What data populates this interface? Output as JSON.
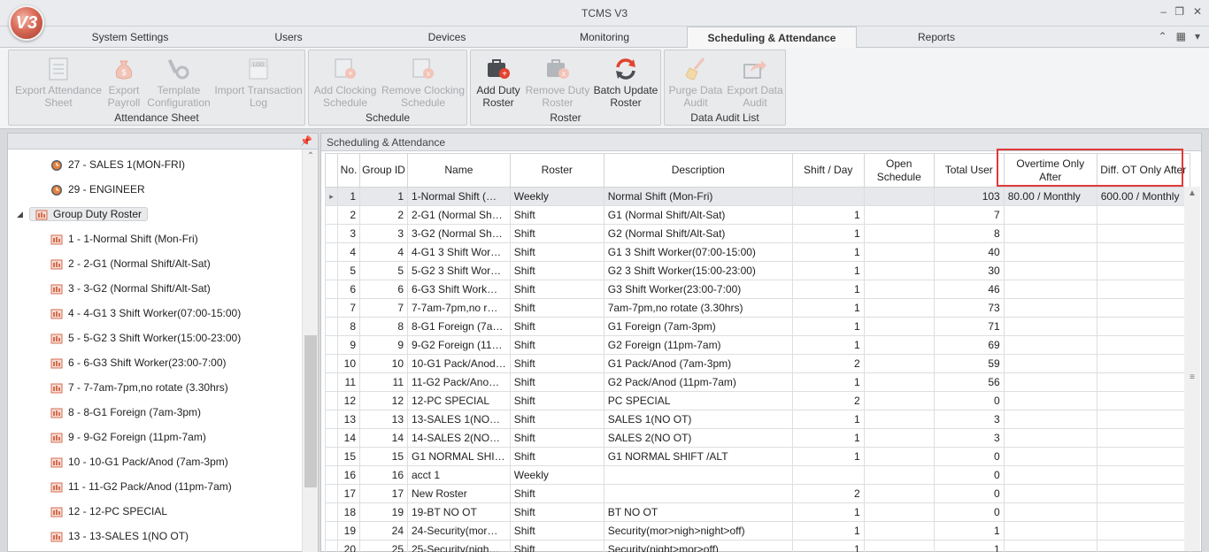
{
  "window": {
    "title": "TCMS V3",
    "logo_text": "V3"
  },
  "tabs": [
    {
      "label": "System Settings"
    },
    {
      "label": "Users"
    },
    {
      "label": "Devices"
    },
    {
      "label": "Monitoring"
    },
    {
      "label": "Scheduling & Attendance",
      "active": true
    },
    {
      "label": "Reports"
    }
  ],
  "ribbon": {
    "groups": [
      {
        "name": "Attendance Sheet",
        "buttons": [
          {
            "label1": "Export Attendance",
            "label2": "Sheet",
            "icon": "sheet-icon",
            "enabled": false
          },
          {
            "label1": "Export",
            "label2": "Payroll",
            "icon": "money-bag-icon",
            "enabled": false
          },
          {
            "label1": "Template",
            "label2": "Configuration",
            "icon": "tools-icon",
            "enabled": false
          },
          {
            "label1": "Import Transaction",
            "label2": "Log",
            "icon": "log-icon",
            "enabled": false
          }
        ]
      },
      {
        "name": "Schedule",
        "buttons": [
          {
            "label1": "Add Clocking",
            "label2": "Schedule",
            "icon": "add-schedule-icon",
            "enabled": false
          },
          {
            "label1": "Remove Clocking",
            "label2": "Schedule",
            "icon": "remove-schedule-icon",
            "enabled": false
          }
        ]
      },
      {
        "name": "Roster",
        "buttons": [
          {
            "label1": "Add Duty",
            "label2": "Roster",
            "icon": "add-roster-icon",
            "enabled": true
          },
          {
            "label1": "Remove Duty",
            "label2": "Roster",
            "icon": "remove-roster-icon",
            "enabled": false
          },
          {
            "label1": "Batch Update",
            "label2": "Roster",
            "icon": "refresh-icon",
            "enabled": true
          }
        ]
      },
      {
        "name": "Data Audit List",
        "buttons": [
          {
            "label1": "Purge Data",
            "label2": "Audit",
            "icon": "broom-icon",
            "enabled": false
          },
          {
            "label1": "Export Data",
            "label2": "Audit",
            "icon": "export-icon",
            "enabled": false
          }
        ]
      }
    ]
  },
  "tree": {
    "items": [
      {
        "label": "27 - SALES 1(MON-FRI)",
        "level": 2,
        "icon": "clock-icon"
      },
      {
        "label": "29 - ENGINEER",
        "level": 2,
        "icon": "clock-icon"
      },
      {
        "label": "Group Duty Roster",
        "level": 1,
        "icon": "roster-icon",
        "expanded": true
      },
      {
        "label": "1 - 1-Normal Shift (Mon-Fri)",
        "level": 2,
        "icon": "roster-icon"
      },
      {
        "label": "2 - 2-G1 (Normal Shift/Alt-Sat)",
        "level": 2,
        "icon": "roster-icon"
      },
      {
        "label": "3 - 3-G2 (Normal Shift/Alt-Sat)",
        "level": 2,
        "icon": "roster-icon"
      },
      {
        "label": "4 - 4-G1 3 Shift Worker(07:00-15:00)",
        "level": 2,
        "icon": "roster-icon"
      },
      {
        "label": "5 - 5-G2 3 Shift Worker(15:00-23:00)",
        "level": 2,
        "icon": "roster-icon"
      },
      {
        "label": "6 - 6-G3 Shift Worker(23:00-7:00)",
        "level": 2,
        "icon": "roster-icon"
      },
      {
        "label": "7 - 7-7am-7pm,no rotate (3.30hrs)",
        "level": 2,
        "icon": "roster-icon"
      },
      {
        "label": "8 - 8-G1 Foreign (7am-3pm)",
        "level": 2,
        "icon": "roster-icon"
      },
      {
        "label": "9 - 9-G2 Foreign (11pm-7am)",
        "level": 2,
        "icon": "roster-icon"
      },
      {
        "label": "10 - 10-G1 Pack/Anod (7am-3pm)",
        "level": 2,
        "icon": "roster-icon"
      },
      {
        "label": "11 - 11-G2 Pack/Anod (11pm-7am)",
        "level": 2,
        "icon": "roster-icon"
      },
      {
        "label": "12 - 12-PC SPECIAL",
        "level": 2,
        "icon": "roster-icon"
      },
      {
        "label": "13 - 13-SALES 1(NO OT)",
        "level": 2,
        "icon": "roster-icon"
      }
    ]
  },
  "main": {
    "panel_title": "Scheduling & Attendance",
    "columns": [
      "No.",
      "Group ID",
      "Name",
      "Roster",
      "Description",
      "Shift / Day",
      "Open Schedule",
      "Total User",
      "Overtime Only After",
      "Diff. OT Only After"
    ],
    "rows": [
      [
        "1",
        "1",
        "1-Normal Shift (…",
        "Weekly",
        "Normal Shift (Mon-Fri)",
        "",
        "",
        "103",
        "80.00 / Monthly",
        "600.00 / Monthly"
      ],
      [
        "2",
        "2",
        "2-G1 (Normal Sh…",
        "Shift",
        "G1 (Normal Shift/Alt-Sat)",
        "1",
        "",
        "7",
        "",
        ""
      ],
      [
        "3",
        "3",
        "3-G2 (Normal Sh…",
        "Shift",
        "G2 (Normal Shift/Alt-Sat)",
        "1",
        "",
        "8",
        "",
        ""
      ],
      [
        "4",
        "4",
        "4-G1 3 Shift Wor…",
        "Shift",
        "G1 3 Shift Worker(07:00-15:00)",
        "1",
        "",
        "40",
        "",
        ""
      ],
      [
        "5",
        "5",
        "5-G2 3 Shift Wor…",
        "Shift",
        "G2 3 Shift Worker(15:00-23:00)",
        "1",
        "",
        "30",
        "",
        ""
      ],
      [
        "6",
        "6",
        "6-G3 Shift Work…",
        "Shift",
        "G3 Shift Worker(23:00-7:00)",
        "1",
        "",
        "46",
        "",
        ""
      ],
      [
        "7",
        "7",
        "7-7am-7pm,no r…",
        "Shift",
        "7am-7pm,no rotate (3.30hrs)",
        "1",
        "",
        "73",
        "",
        ""
      ],
      [
        "8",
        "8",
        "8-G1 Foreign (7a…",
        "Shift",
        "G1 Foreign (7am-3pm)",
        "1",
        "",
        "71",
        "",
        ""
      ],
      [
        "9",
        "9",
        "9-G2 Foreign (11…",
        "Shift",
        "G2 Foreign (11pm-7am)",
        "1",
        "",
        "69",
        "",
        ""
      ],
      [
        "10",
        "10",
        "10-G1 Pack/Anod…",
        "Shift",
        "G1 Pack/Anod (7am-3pm)",
        "2",
        "",
        "59",
        "",
        ""
      ],
      [
        "11",
        "11",
        "11-G2 Pack/Ano…",
        "Shift",
        "G2 Pack/Anod (11pm-7am)",
        "1",
        "",
        "56",
        "",
        ""
      ],
      [
        "12",
        "12",
        "12-PC SPECIAL",
        "Shift",
        "PC SPECIAL",
        "2",
        "",
        "0",
        "",
        ""
      ],
      [
        "13",
        "13",
        "13-SALES 1(NO…",
        "Shift",
        "SALES 1(NO OT)",
        "1",
        "",
        "3",
        "",
        ""
      ],
      [
        "14",
        "14",
        "14-SALES 2(NO…",
        "Shift",
        "SALES 2(NO OT)",
        "1",
        "",
        "3",
        "",
        ""
      ],
      [
        "15",
        "15",
        "G1 NORMAL SHI…",
        "Shift",
        "G1 NORMAL SHIFT /ALT",
        "1",
        "",
        "0",
        "",
        ""
      ],
      [
        "16",
        "16",
        "acct 1",
        "Weekly",
        "",
        "",
        "",
        "0",
        "",
        ""
      ],
      [
        "17",
        "17",
        "New Roster",
        "Shift",
        "",
        "2",
        "",
        "0",
        "",
        ""
      ],
      [
        "18",
        "19",
        "19-BT NO OT",
        "Shift",
        "BT NO OT",
        "1",
        "",
        "0",
        "",
        ""
      ],
      [
        "19",
        "24",
        "24-Security(mor…",
        "Shift",
        "Security(mor>nigh>night>off)",
        "1",
        "",
        "1",
        "",
        ""
      ],
      [
        "20",
        "25",
        "25-Security(nigh…",
        "Shift",
        "Security(night>mor>off)",
        "1",
        "",
        "1",
        "",
        ""
      ]
    ]
  }
}
